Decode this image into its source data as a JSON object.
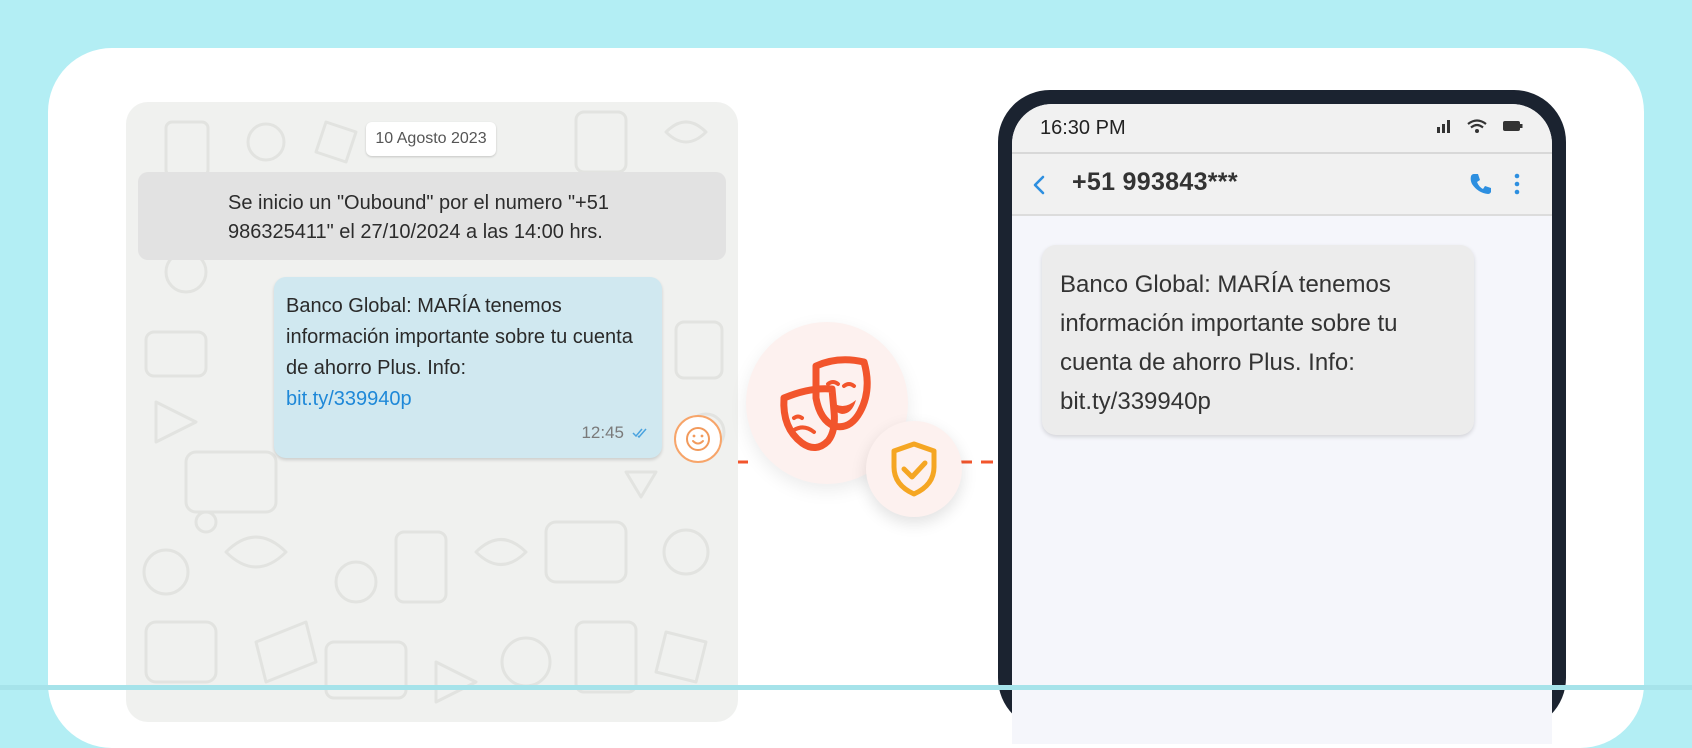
{
  "chat": {
    "date": "10 Agosto 2023",
    "system_message": "Se inicio un \"Oubound\" por el numero \"+51\n986325411\" el  27/10/2024 a las 14:00 hrs.",
    "bubble": {
      "text": "Banco Global: MARÍA tenemos información importante sobre tu cuenta de ahorro Plus. Info:",
      "link": "bit.ty/339940p",
      "time": "12:45"
    }
  },
  "phone": {
    "status_time": "16:30 PM",
    "contact": "+51 993843***",
    "sms_lines": [
      "Banco Global: MARÍA tenemos",
      "información importante sobre tu",
      "cuenta de ahorro Plus. Info:",
      "bit.ty/339940p"
    ]
  },
  "colors": {
    "background": "#b3eef4",
    "accent_orange": "#f2552c",
    "shield_orange": "#f5a623",
    "link_blue": "#1e88d8",
    "phone_frame": "#1b2330"
  },
  "icons": [
    "theater-masks-icon",
    "shield-check-icon",
    "smiley-icon",
    "double-check-icon",
    "back-icon",
    "phone-call-icon",
    "more-vertical-icon",
    "signal-icon",
    "wifi-icon",
    "battery-icon"
  ]
}
